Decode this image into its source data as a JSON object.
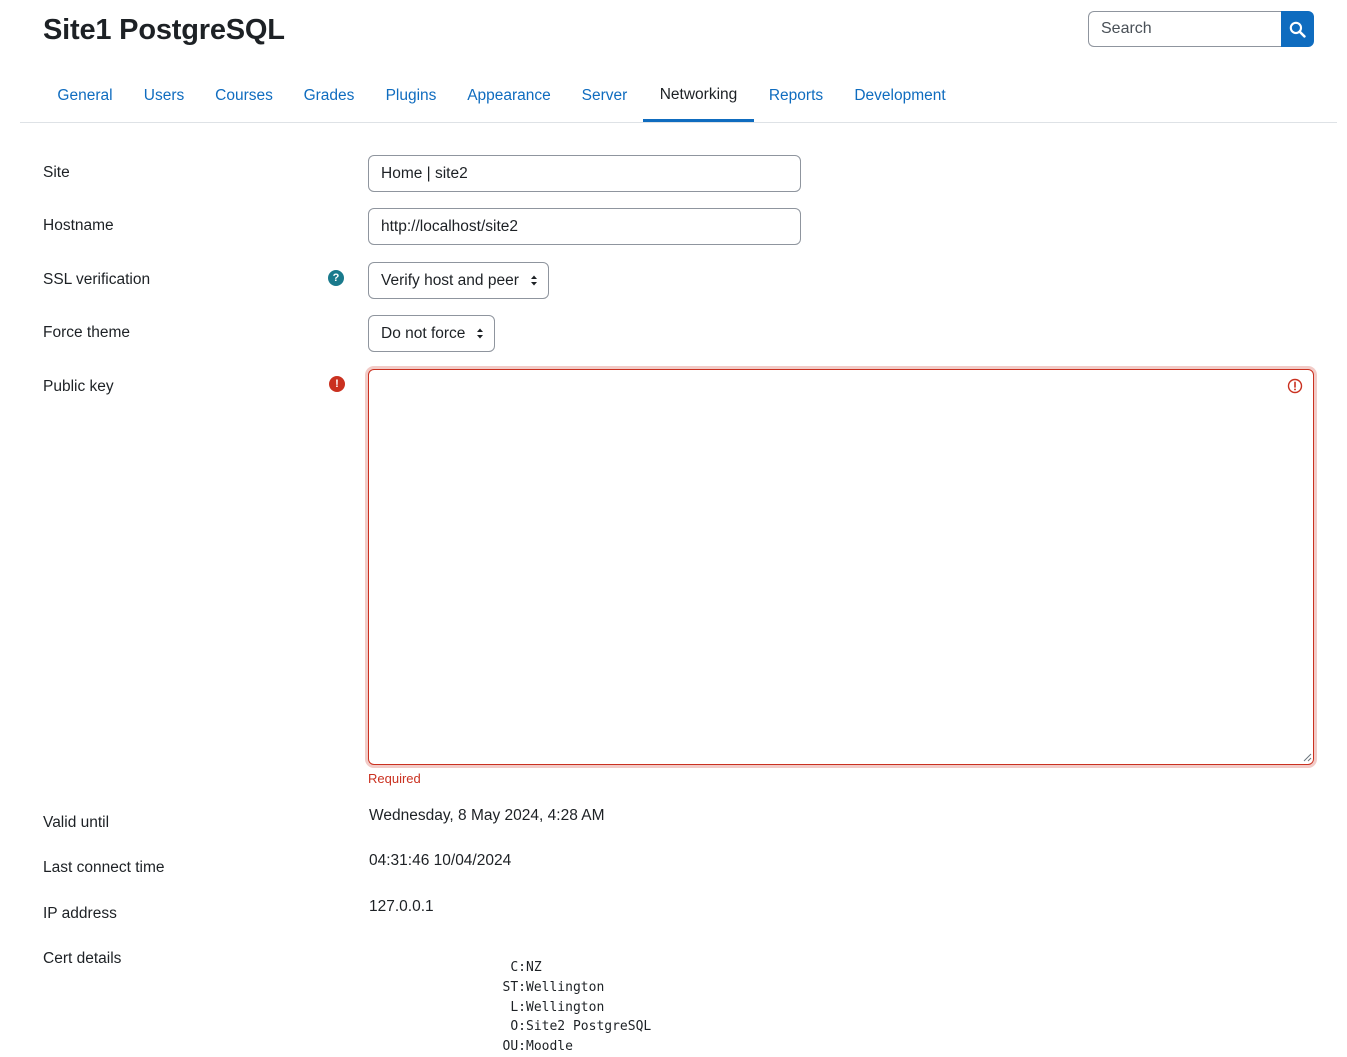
{
  "page_title": "Site1 PostgreSQL",
  "search": {
    "placeholder": "Search"
  },
  "tabs": [
    {
      "label": "General"
    },
    {
      "label": "Users"
    },
    {
      "label": "Courses"
    },
    {
      "label": "Grades"
    },
    {
      "label": "Plugins"
    },
    {
      "label": "Appearance"
    },
    {
      "label": "Server"
    },
    {
      "label": "Networking",
      "active": true
    },
    {
      "label": "Reports"
    },
    {
      "label": "Development"
    }
  ],
  "form": {
    "site": {
      "label": "Site",
      "value": "Home | site2"
    },
    "hostname": {
      "label": "Hostname",
      "value": "http://localhost/site2"
    },
    "ssl": {
      "label": "SSL verification",
      "value": "Verify host and peer"
    },
    "force_theme": {
      "label": "Force theme",
      "value": "Do not force"
    },
    "public_key": {
      "label": "Public key",
      "value": "",
      "error": "Required"
    },
    "valid_until": {
      "label": "Valid until",
      "value": "Wednesday, 8 May 2024, 4:28 AM"
    },
    "last_connect": {
      "label": "Last connect time",
      "value": "04:31:46 10/04/2024"
    },
    "ip": {
      "label": "IP address",
      "value": "127.0.0.1"
    },
    "cert": {
      "label": "Cert details",
      "lines": [
        {
          "key": "C:",
          "value": "NZ"
        },
        {
          "key": "ST:",
          "value": "Wellington"
        },
        {
          "key": "L:",
          "value": "Wellington"
        },
        {
          "key": "O:",
          "value": "Site2 PostgreSQL"
        },
        {
          "key": "OU:",
          "value": "Moodle"
        }
      ]
    }
  },
  "colors": {
    "link": "#0f6cbf",
    "error": "#ca3120",
    "help": "#1a7a8c",
    "text": "#1d2125"
  }
}
